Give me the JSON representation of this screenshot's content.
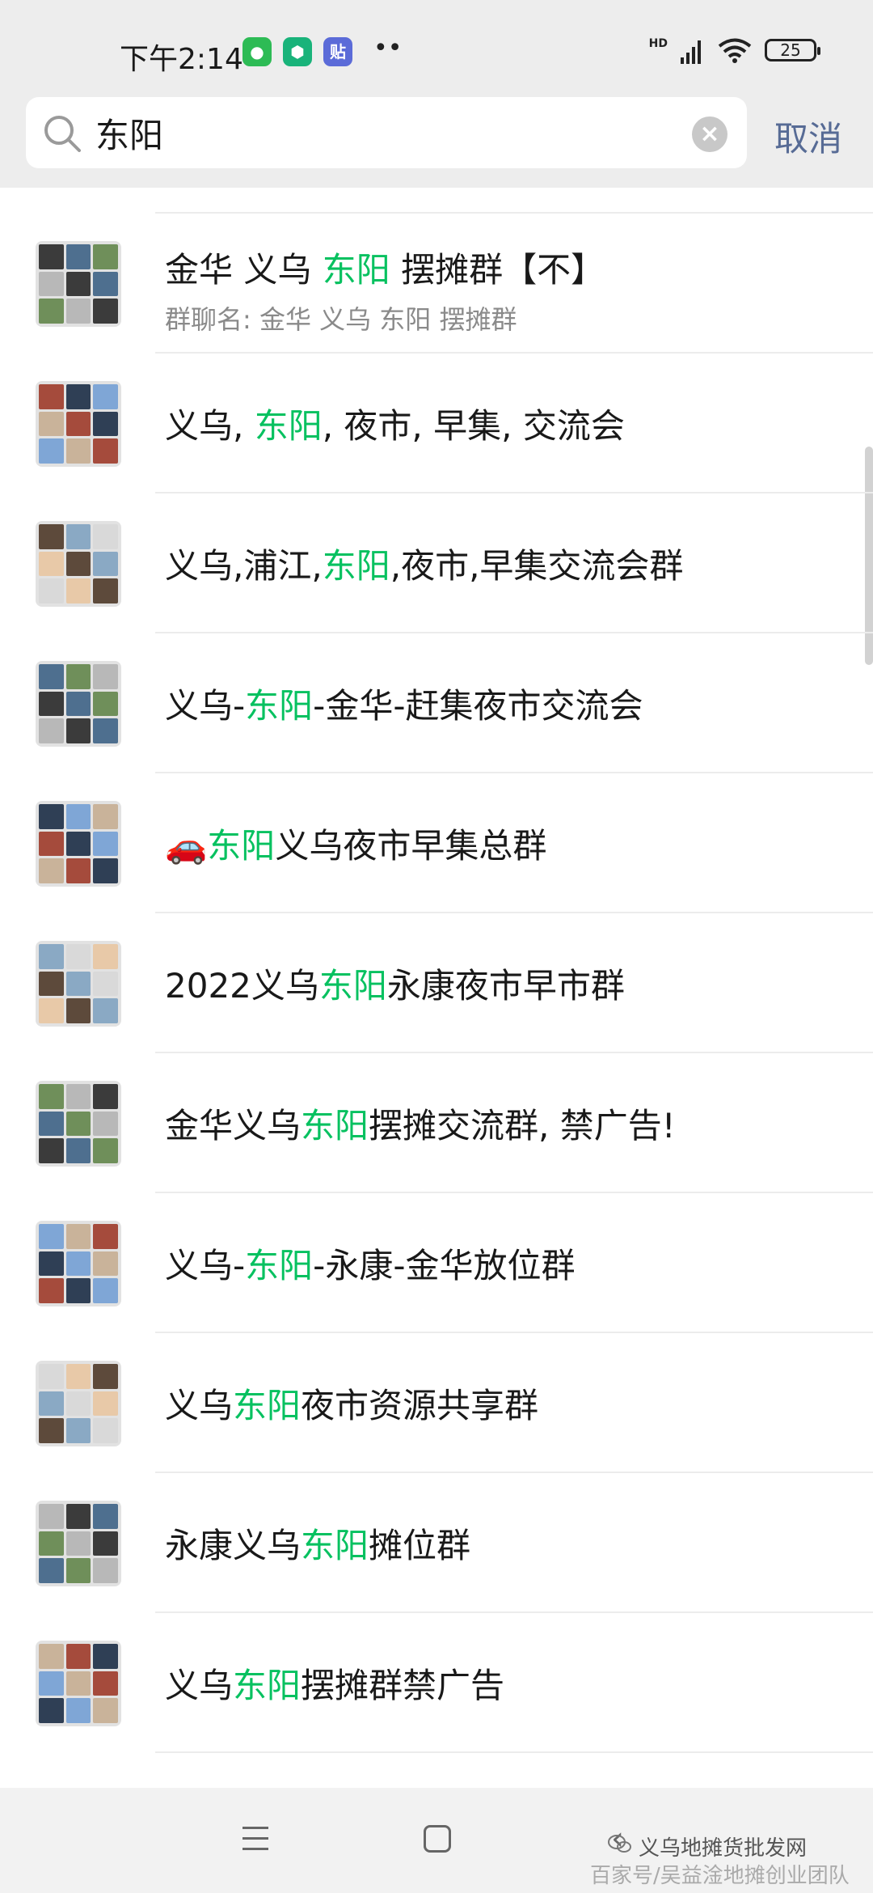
{
  "status_bar": {
    "time": "下午2:14",
    "apps": [
      {
        "name": "wechat-icon",
        "glyph": "●",
        "color": "#2dbb55"
      },
      {
        "name": "shield-app-icon",
        "glyph": "⬢",
        "color": "#19b37a"
      },
      {
        "name": "tieba-app-icon",
        "glyph": "贴",
        "color": "#5b6bd8"
      }
    ],
    "more": "••",
    "network": "HD",
    "battery": "25"
  },
  "search": {
    "query": "东阳",
    "cancel_label": "取消"
  },
  "results": [
    {
      "before": "金华 义乌 ",
      "highlight": "东阳",
      "after": " 摆摊群【不】",
      "subtitle": "群聊名: 金华 义乌 东阳 摆摊群"
    },
    {
      "before": "义乌, ",
      "highlight": "东阳",
      "after": ", 夜市, 早集, 交流会"
    },
    {
      "before": "义乌,浦江,",
      "highlight": "东阳",
      "after": ",夜市,早集交流会群"
    },
    {
      "before": "义乌-",
      "highlight": "东阳",
      "after": "-金华-赶集夜市交流会"
    },
    {
      "before": "🚗",
      "highlight": "东阳",
      "after": "义乌夜市早集总群"
    },
    {
      "before": "2022义乌",
      "highlight": "东阳",
      "after": "永康夜市早市群"
    },
    {
      "before": "金华义乌",
      "highlight": "东阳",
      "after": "摆摊交流群, 禁广告!"
    },
    {
      "before": "义乌-",
      "highlight": "东阳",
      "after": "-永康-金华放位群"
    },
    {
      "before": "义乌",
      "highlight": "东阳",
      "after": "夜市资源共享群"
    },
    {
      "before": "永康义乌",
      "highlight": "东阳",
      "after": "摊位群"
    },
    {
      "before": "义乌",
      "highlight": "东阳",
      "after": "摆摊群禁广告"
    }
  ],
  "colors": {
    "highlight": "#07c160",
    "cancel": "#576b95",
    "subtitle": "#8a8a8a"
  },
  "watermark": {
    "text": "义乌地摊货批发网",
    "source": "百家号/吴益淦地摊创业团队"
  }
}
